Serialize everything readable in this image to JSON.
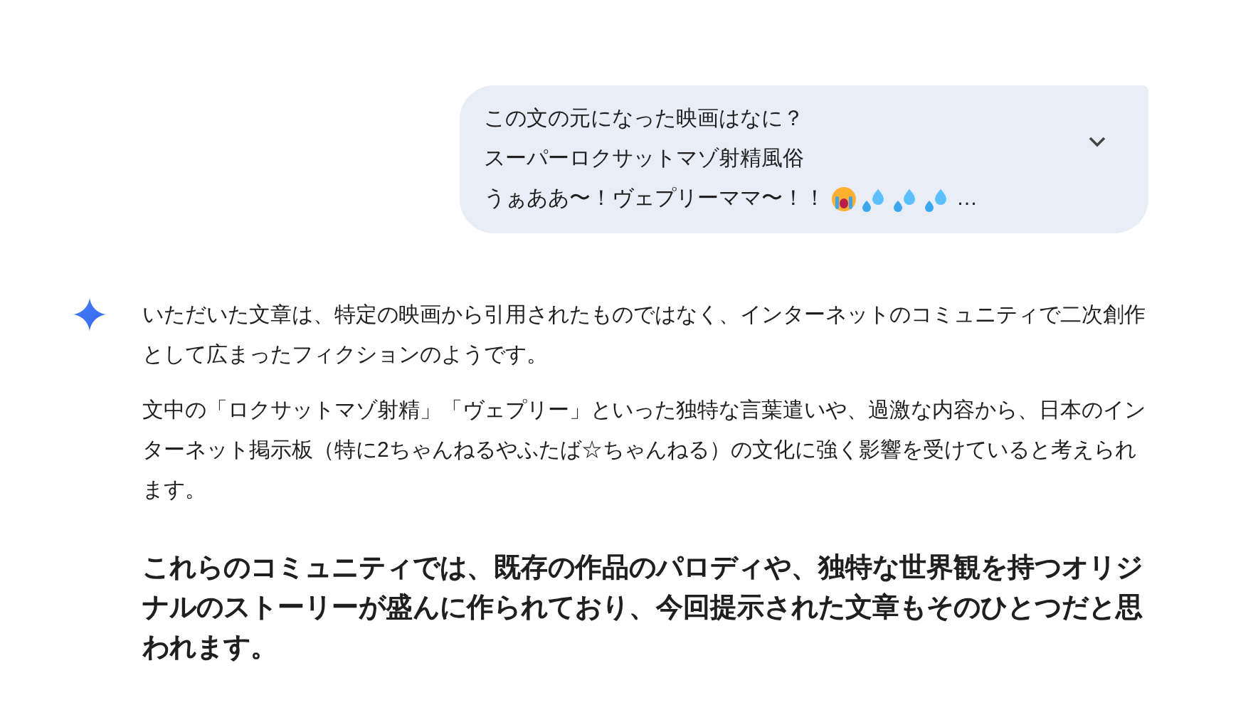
{
  "user_message": {
    "lines": [
      "この文の元になった映画はなに？",
      "スーパーロクサットマゾ射精風俗"
    ],
    "last_line": {
      "text": "うぁああ〜！ヴェプリーママ〜！！",
      "trailing": "…"
    },
    "expanded": false
  },
  "response": {
    "paragraphs": [
      {
        "kind": "normal",
        "text": "いただいた文章は、特定の映画から引用されたものではなく、インターネットのコミュニティで二次創作として広まったフィクションのようです。"
      },
      {
        "kind": "normal",
        "text": "文中の「ロクサットマゾ射精」「ヴェプリー」といった独特な言葉遣いや、過激な内容から、日本のインターネット掲示板（特に2ちゃんねるやふたば☆ちゃんねる）の文化に強く影響を受けていると考えられます。"
      },
      {
        "kind": "heading",
        "text": "これらのコミュニティでは、既存の作品のパロディや、独特な世界観を持つオリジナルのストーリーが盛んに作られており、今回提示された文章もそのひとつだと思われます。"
      }
    ]
  }
}
